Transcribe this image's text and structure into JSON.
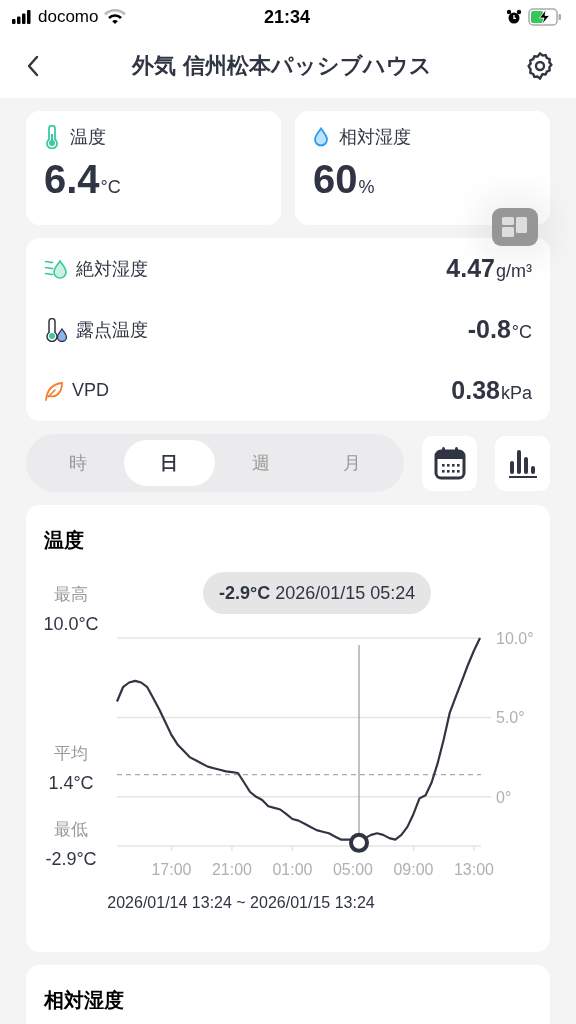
{
  "status_bar": {
    "carrier": "docomo",
    "time": "21:34"
  },
  "nav": {
    "title": "外気 信州松本パッシブハウス"
  },
  "summary": [
    {
      "kind": "temperature",
      "label": "温度",
      "value": "6.4",
      "unit": "°C"
    },
    {
      "kind": "humidity",
      "label": "相対湿度",
      "value": "60",
      "unit": "%"
    }
  ],
  "metrics": [
    {
      "kind": "absolute_humidity",
      "label": "絶対湿度",
      "value": "4.47",
      "unit": "g/m³"
    },
    {
      "kind": "dew_point",
      "label": "露点温度",
      "value": "-0.8",
      "unit": "°C"
    },
    {
      "kind": "vpd",
      "label": "VPD",
      "value": "0.38",
      "unit": "kPa"
    }
  ],
  "period_tabs": [
    {
      "label": "時",
      "selected": false
    },
    {
      "label": "日",
      "selected": true
    },
    {
      "label": "週",
      "selected": false
    },
    {
      "label": "月",
      "selected": false
    }
  ],
  "chart_card": {
    "stats": [
      {
        "label": "最高",
        "value": "10.0°C"
      },
      {
        "label": "平均",
        "value": "1.4°C"
      },
      {
        "label": "最低",
        "value": "-2.9°C"
      }
    ],
    "tooltip": "**-2.9°C** 2026/01/15 05:24",
    "range": "2026/01/14 13:24 ~ 2026/01/15 13:24",
    "chart_data": {
      "type": "line",
      "title": "温度",
      "categories": [
        null,
        null,
        null,
        null,
        null,
        null,
        null,
        null,
        null,
        "17:00",
        null,
        null,
        null,
        null,
        null,
        null,
        null,
        null,
        null,
        "21:00",
        null,
        null,
        null,
        null,
        null,
        null,
        null,
        null,
        null,
        "01:00",
        null,
        null,
        null,
        null,
        null,
        null,
        null,
        null,
        null,
        "05:00",
        null,
        null,
        null,
        null,
        null,
        null,
        null,
        null,
        null,
        "09:00",
        null,
        null,
        null,
        null,
        null,
        null,
        null,
        null,
        null,
        "13:00",
        null
      ],
      "series": [
        {
          "color": "#2f3542",
          "values": [
            6.0,
            6.9,
            7.2,
            7.3,
            7.2,
            6.9,
            6.2,
            5.5,
            4.7,
            3.9,
            3.3,
            2.9,
            2.5,
            2.3,
            2.1,
            1.9,
            1.8,
            1.7,
            1.6,
            1.55,
            1.5,
            0.9,
            0.3,
            0.0,
            -0.2,
            -0.6,
            -0.7,
            -0.8,
            -1.1,
            -1.4,
            -1.5,
            -1.7,
            -1.9,
            -2.1,
            -2.2,
            -2.3,
            -2.5,
            -2.7,
            -2.7,
            -2.7,
            -2.9,
            -2.6,
            -2.4,
            -2.3,
            -2.4,
            -2.6,
            -2.7,
            -2.4,
            -1.9,
            -1.1,
            -0.1,
            0.1,
            0.9,
            2.1,
            3.6,
            5.3,
            6.3,
            7.3,
            8.3,
            9.2,
            10.0
          ]
        }
      ],
      "ylim": [
        -3.1,
        10
      ],
      "yticks": [
        {
          "value": 0,
          "label": "0°"
        },
        {
          "value": 5,
          "label": "5.0°"
        },
        {
          "value": 10,
          "label": "10.0°"
        }
      ],
      "ref_lines": [
        {
          "axis": "y",
          "value": 1.4
        }
      ]
    }
  },
  "next_card": {
    "title": "相対湿度"
  }
}
